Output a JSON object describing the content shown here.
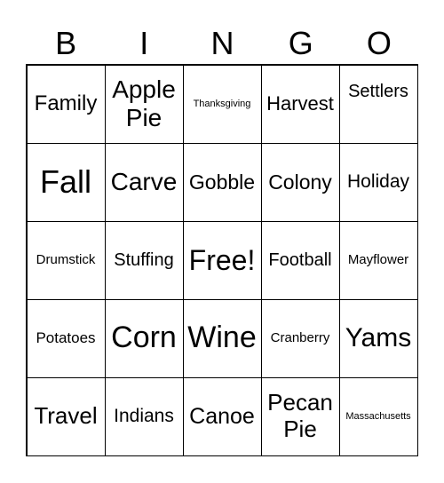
{
  "header": [
    "B",
    "I",
    "N",
    "G",
    "O"
  ],
  "cells": [
    "Family",
    "Apple Pie",
    "Thanksgiving",
    "Harvest",
    "Settlers",
    "Fall",
    "Carve",
    "Gobble",
    "Colony",
    "Holiday",
    "Drumstick",
    "Stuffing",
    "Free!",
    "Football",
    "Mayflower",
    "Potatoes",
    "Corn",
    "Wine",
    "Cranberry",
    "Yams",
    "Travel",
    "Indians",
    "Canoe",
    "Pecan Pie",
    "Massachusetts"
  ]
}
